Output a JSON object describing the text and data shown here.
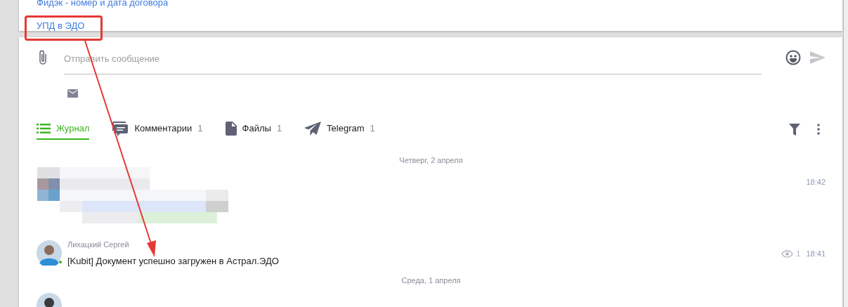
{
  "top_card": {
    "links": [
      {
        "label": "Фидэк - номер и дата договора"
      },
      {
        "label": "УПД в ЭДО",
        "highlighted": true
      }
    ]
  },
  "composer": {
    "placeholder": "Отправить сообщение"
  },
  "tabs": [
    {
      "label": "Журнал",
      "selected": true
    },
    {
      "label": "Комментарии",
      "count": "1",
      "selected": false
    },
    {
      "label": "Файлы",
      "count": "1",
      "selected": false
    },
    {
      "label": "Telegram",
      "count": "1",
      "selected": false
    }
  ],
  "feed": [
    {
      "kind": "date",
      "text": "Четверг, 2 апреля"
    },
    {
      "kind": "picture",
      "time": "18:42"
    },
    {
      "kind": "message",
      "author": "Лихацкий Сергей",
      "text": "[Kubit] Документ успешно загружен в Астрал.ЭДО",
      "views": "1",
      "time": "18:41",
      "online": true
    },
    {
      "kind": "date",
      "text": "Среда, 1 апреля"
    },
    {
      "kind": "avatar_only"
    }
  ]
}
